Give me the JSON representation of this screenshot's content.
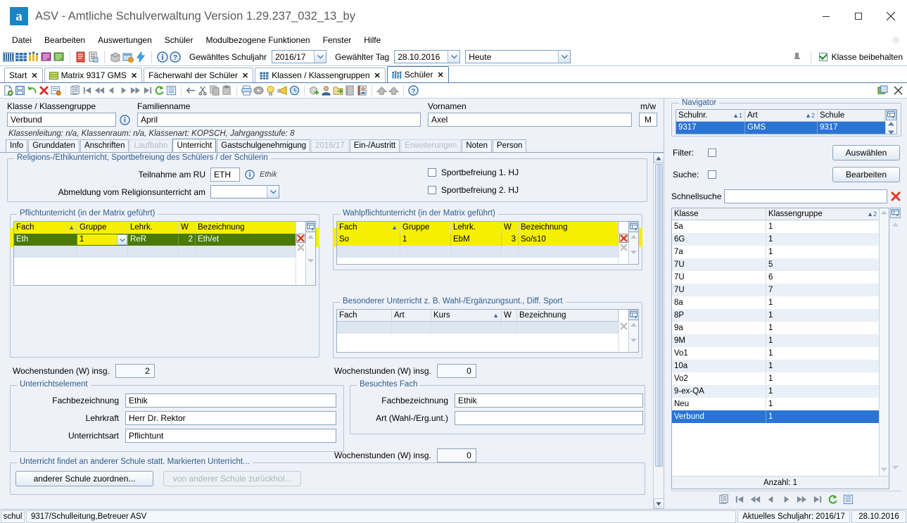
{
  "window": {
    "title": "ASV - Amtliche Schulverwaltung Version 1.29.237_032_13_by",
    "logo_letter": "a",
    "minimize": "–",
    "maximize": "□",
    "close": "✕"
  },
  "menubar": {
    "items": [
      "Datei",
      "Bearbeiten",
      "Auswertungen",
      "Schüler",
      "Modulbezogene Funktionen",
      "Fenster",
      "Hilfe"
    ]
  },
  "toolbar": {
    "schuljahr_label": "Gewähltes Schuljahr",
    "schuljahr_value": "2016/17",
    "tag_label": "Gewählter Tag",
    "tag_value": "28.10.2016",
    "heute_value": "Heute",
    "klasse_beibehalten": "Klasse beibehalten",
    "klasse_beibehalten_checked": true
  },
  "tabs": [
    {
      "label": "Start",
      "icon": "none",
      "active": false
    },
    {
      "label": "Matrix 9317 GMS",
      "icon": "matrix-icon",
      "active": false
    },
    {
      "label": "Fächerwahl der Schüler",
      "icon": "none",
      "active": false
    },
    {
      "label": "Klassen / Klassengruppen",
      "icon": "classes-icon",
      "active": false
    },
    {
      "label": "Schüler",
      "icon": "students-icon",
      "active": true
    }
  ],
  "header_fields": {
    "klasse_label": "Klasse / Klassengruppe",
    "klasse_value": "Verbund",
    "familienname_label": "Familienname",
    "familienname_value": "April",
    "vornamen_label": "Vornamen",
    "vornamen_value": "Axel",
    "mw_label": "m/w",
    "mw_value": "M",
    "info_line": "Klassenleitung: n/a, Klassenraum: n/a, Klassenart: KOPSCH, Jahrgangsstufe: 8"
  },
  "subtabs": [
    {
      "label": "Info",
      "state": "normal"
    },
    {
      "label": "Grunddaten",
      "state": "normal"
    },
    {
      "label": "Anschriften",
      "state": "normal"
    },
    {
      "label": "Laufbahn",
      "state": "disabled"
    },
    {
      "label": "Unterricht",
      "state": "active"
    },
    {
      "label": "Gastschulgenehmigung",
      "state": "normal"
    },
    {
      "label": "2016/17",
      "state": "disabled"
    },
    {
      "label": "Ein-/Austritt",
      "state": "normal"
    },
    {
      "label": "Erweiterungen",
      "state": "disabled"
    },
    {
      "label": "Noten",
      "state": "normal"
    },
    {
      "label": "Person",
      "state": "normal"
    }
  ],
  "religion_group": {
    "title": "Religions-/Ethikunterricht, Sportbefreiung des Schülers / der Schülerin",
    "teilnahme_label": "Teilnahme am RU",
    "teilnahme_value": "ETH",
    "teilnahme_hint": "Ethik",
    "abmeldung_label": "Abmeldung vom Religionsunterricht am",
    "abmeldung_value": "",
    "sport1_label": "Sportbefreiung 1. HJ",
    "sport1_checked": false,
    "sport2_label": "Sportbefreiung 2. HJ",
    "sport2_checked": false
  },
  "pflicht": {
    "title": "Pflichtunterricht (in der Matrix geführt)",
    "columns": [
      "Fach",
      "Gruppe",
      "Lehrk.",
      "W",
      "Bezeichnung"
    ],
    "sort_col": "Fach",
    "rows": [
      {
        "fach": "Eth",
        "gruppe": "1",
        "lehrk": "ReR",
        "w": "2",
        "bezeichnung": "Eth/et",
        "selected": true,
        "highlighted": true
      }
    ],
    "wochenstunden_label": "Wochenstunden (W) insg.",
    "wochenstunden_value": "2"
  },
  "wahlpflicht": {
    "title": "Wahlpflichtunterricht (in der Matrix geführt)",
    "columns": [
      "Fach",
      "Gruppe",
      "Lehrk.",
      "W",
      "Bezeichnung"
    ],
    "sort_col": "Fach",
    "rows": [
      {
        "fach": "So",
        "gruppe": "1",
        "lehrk": "EbM",
        "w": "3",
        "bezeichnung": "So/s10",
        "selected": false,
        "highlighted": true
      }
    ],
    "wochenstunden_label": "Wochenstunden (W) insg.",
    "wochenstunden_value": "0"
  },
  "besonderer": {
    "title": "Besonderer Unterricht z. B. Wahl-/Ergänzungsunt., Diff. Sport",
    "columns": [
      "Fach",
      "Art",
      "Kurs",
      "W",
      "Bezeichnung"
    ],
    "sort_col": "Kurs",
    "rows": [],
    "wochenstunden_label": "Wochenstunden (W) insg.",
    "wochenstunden_value": "0"
  },
  "unterrichtselement": {
    "title": "Unterrichtselement",
    "fields": [
      {
        "label": "Fachbezeichnung",
        "value": "Ethik"
      },
      {
        "label": "Lehrkraft",
        "value": "Herr Dr. Rektor"
      },
      {
        "label": "Unterrichtsart",
        "value": "Pflichtunt"
      }
    ]
  },
  "besuchtes_fach": {
    "title": "Besuchtes Fach",
    "fields": [
      {
        "label": "Fachbezeichnung",
        "value": "Ethik"
      },
      {
        "label": "Art (Wahl-/Erg.unt.)",
        "value": ""
      }
    ]
  },
  "andere_schule": {
    "title": "Unterricht findet an anderer Schule statt. Markierten Unterricht...",
    "btn_zuordnen": "anderer Schule zuordnen...",
    "btn_zurueck": "von anderer Schule zurückhol..."
  },
  "navigator": {
    "title": "Navigator",
    "top_columns": [
      "Schulnr.",
      "Art",
      "Schule"
    ],
    "top_sort": [
      "1",
      "2"
    ],
    "top_rows": [
      {
        "schulnr": "9317",
        "art": "GMS",
        "schule": "9317",
        "selected": true
      }
    ],
    "filter_label": "Filter:",
    "filter_checked": false,
    "suche_label": "Suche:",
    "suche_checked": false,
    "btn_auswaehlen": "Auswählen",
    "btn_bearbeiten": "Bearbeiten",
    "schnellsuche_label": "Schnellsuche",
    "schnellsuche_value": "",
    "list_columns": [
      "Klasse",
      "Klassengruppe"
    ],
    "list_sort": "2",
    "rows": [
      {
        "klasse": "5a",
        "gruppe": "1",
        "selected": false
      },
      {
        "klasse": "6G",
        "gruppe": "1",
        "selected": false
      },
      {
        "klasse": "7a",
        "gruppe": "1",
        "selected": false
      },
      {
        "klasse": "7U",
        "gruppe": "5",
        "selected": false
      },
      {
        "klasse": "7U",
        "gruppe": "6",
        "selected": false
      },
      {
        "klasse": "7U",
        "gruppe": "7",
        "selected": false
      },
      {
        "klasse": "8a",
        "gruppe": "1",
        "selected": false
      },
      {
        "klasse": "8P",
        "gruppe": "1",
        "selected": false
      },
      {
        "klasse": "9a",
        "gruppe": "1",
        "selected": false
      },
      {
        "klasse": "9M",
        "gruppe": "1",
        "selected": false
      },
      {
        "klasse": "Vo1",
        "gruppe": "1",
        "selected": false
      },
      {
        "klasse": "10a",
        "gruppe": "1",
        "selected": false
      },
      {
        "klasse": "Vo2",
        "gruppe": "1",
        "selected": false
      },
      {
        "klasse": "9-ex-QA",
        "gruppe": "1",
        "selected": false
      },
      {
        "klasse": "Neu",
        "gruppe": "1",
        "selected": false
      },
      {
        "klasse": "Verbund",
        "gruppe": "1",
        "selected": true
      }
    ],
    "anzahl": "Anzahl: 1"
  },
  "statusbar": {
    "left": "schul",
    "user": "9317/Schulleitung,Betreuer ASV",
    "schuljahr": "Aktuelles Schuljahr: 2016/17",
    "datum": "28.10.2016"
  },
  "colors": {
    "accent_blue": "#2a74d6",
    "selection_green": "#4a7a08",
    "highlight_yellow": "#f6ef00",
    "group_title": "#2e5d8f"
  }
}
